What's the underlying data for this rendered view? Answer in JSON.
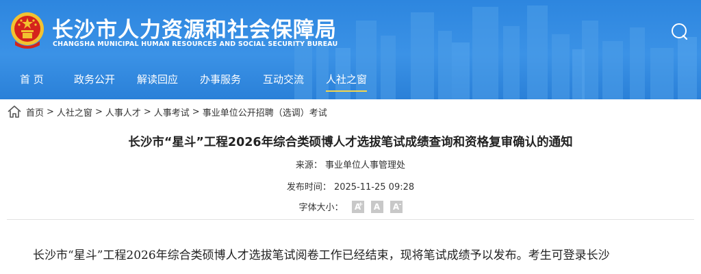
{
  "header": {
    "title_cn": "长沙市人力资源和社会保障局",
    "title_en": "CHANGSHA MUNICIPAL HUMAN RESOURCES AND SOCIAL SECURITY BUREAU",
    "emblem": "national-emblem-icon",
    "search_icon": "search-icon"
  },
  "nav": {
    "items": [
      {
        "label": "首 页"
      },
      {
        "label": "政务公开"
      },
      {
        "label": "解读回应"
      },
      {
        "label": "办事服务"
      },
      {
        "label": "互动交流"
      },
      {
        "label": "人社之窗"
      }
    ],
    "active_index": 5
  },
  "breadcrumb": {
    "icon": "home-icon",
    "items": [
      "首页",
      "人社之窗",
      "人事人才",
      "人事考试",
      "事业单位公开招聘（选调）考试"
    ],
    "separator": ">"
  },
  "article": {
    "title": "长沙市“星斗”工程2026年综合类硕博人才选拔笔试成绩查询和资格复审确认的通知",
    "source": "来源：  事业单位人事管理处",
    "publish_time": "发布时间：  2025-11-25 09:28",
    "font_size_label": "字体大小：",
    "font_buttons": [
      {
        "letter": "A",
        "mark": "+"
      },
      {
        "letter": "A",
        "mark": ""
      },
      {
        "letter": "A",
        "mark": "-"
      }
    ],
    "body_first_line": "长沙市“星斗”工程2026年综合类硕博人才选拔笔试阅卷工作已经结束，现将笔试成绩予以发布。考生可登录长沙"
  },
  "colors": {
    "header_blue": "#2d86df",
    "nav_active_underline": "#f5d64a",
    "emblem_red": "#d5231c",
    "emblem_gold": "#f2c230"
  }
}
